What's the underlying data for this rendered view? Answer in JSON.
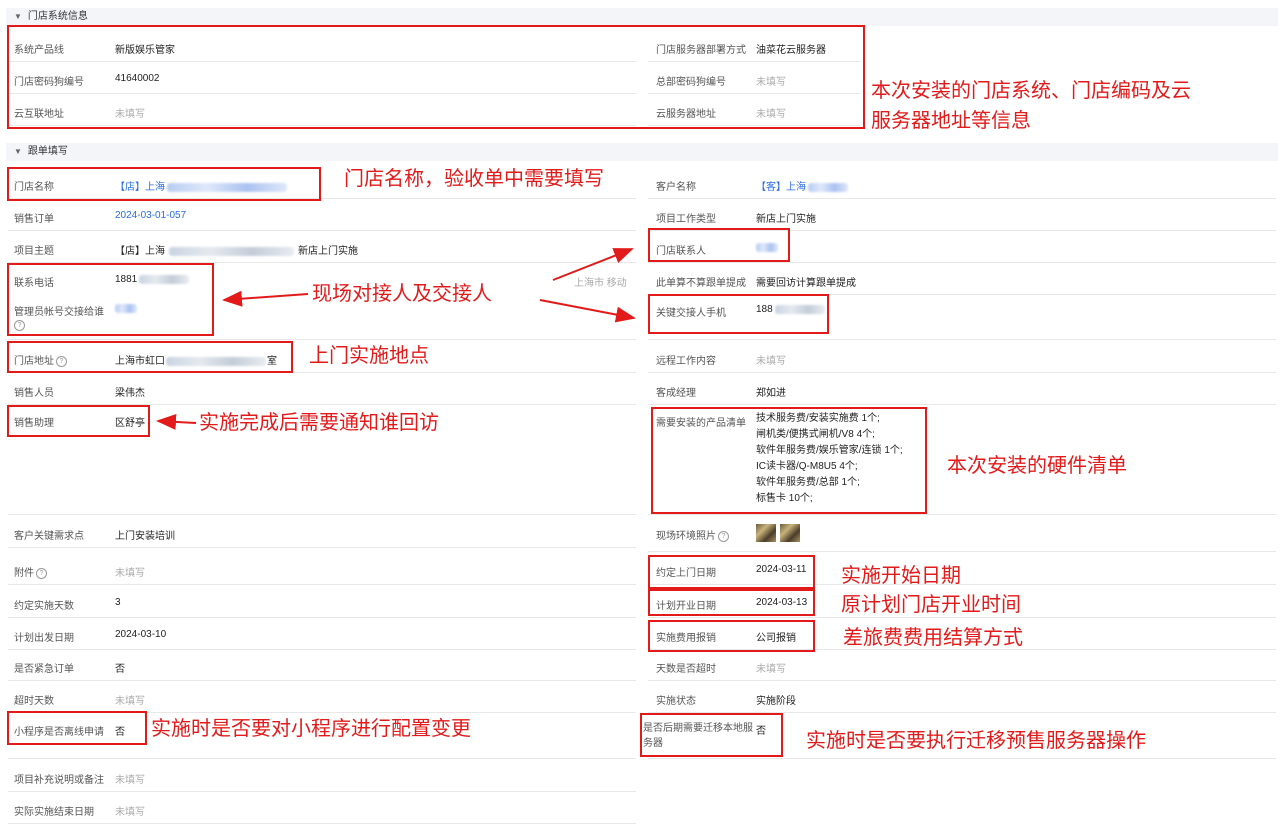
{
  "sections": {
    "store_system": {
      "title": "门店系统信息"
    },
    "order": {
      "title": "跟单填写"
    }
  },
  "store_system": {
    "product_line": {
      "label": "系统产品线",
      "value": "新版娱乐管家"
    },
    "deploy_method": {
      "label": "门店服务器部署方式",
      "value": "油菜花云服务器"
    },
    "store_code": {
      "label": "门店密码狗编号",
      "value": "41640002"
    },
    "hq_code": {
      "label": "总部密码狗编号",
      "value": "未填写"
    },
    "cloud_link": {
      "label": "云互联地址",
      "value": "未填写"
    },
    "cloud_server": {
      "label": "云服务器地址",
      "value": "未填写"
    }
  },
  "order": {
    "store_name": {
      "label": "门店名称",
      "value": "【店】上海"
    },
    "customer_name": {
      "label": "客户名称",
      "value": "【客】上海"
    },
    "sales_order": {
      "label": "销售订单",
      "value": "2024-03-01-057"
    },
    "project_type": {
      "label": "项目工作类型",
      "value": "新店上门实施"
    },
    "project_topic": {
      "label": "项目主题",
      "value": "【店】上海",
      "suffix": "新店上门实施"
    },
    "store_contact": {
      "label": "门店联系人",
      "value": ""
    },
    "phone": {
      "label": "联系电话",
      "value": "1881",
      "carrier": "上海市 移动"
    },
    "tracking_calc": {
      "label": "此单算不算跟单提成",
      "value": "需要回访计算跟单提成"
    },
    "admin_handover": {
      "label": "管理员帐号交接给谁",
      "value": ""
    },
    "key_contact_phone": {
      "label": "关键交接人手机",
      "value": "188"
    },
    "store_address": {
      "label": "门店地址",
      "value": "上海市虹口",
      "suffix": "室"
    },
    "remote_work": {
      "label": "远程工作内容",
      "value": "未填写"
    },
    "sales_person": {
      "label": "销售人员",
      "value": "梁伟杰"
    },
    "cs_manager": {
      "label": "客成经理",
      "value": "郑如进"
    },
    "sales_assistant": {
      "label": "销售助理",
      "value": "区舒亭"
    },
    "product_list": {
      "label": "需要安装的产品清单",
      "items": [
        "技术服务费/安装实施费 1个;",
        "闸机类/便携式闸机/V8 4个;",
        "软件年服务费/娱乐管家/连锁 1个;",
        "IC读卡器/Q-M8U5 4个;",
        "软件年服务费/总部 1个;",
        "标售卡 10个;"
      ]
    },
    "customer_key_needs": {
      "label": "客户关键需求点",
      "value": "上门安装培训"
    },
    "site_photos": {
      "label": "现场环境照片"
    },
    "attachment": {
      "label": "附件",
      "value": "未填写"
    },
    "visit_date": {
      "label": "约定上门日期",
      "value": "2024-03-11"
    },
    "impl_days": {
      "label": "约定实施天数",
      "value": "3"
    },
    "open_date": {
      "label": "计划开业日期",
      "value": "2024-03-13"
    },
    "depart_date": {
      "label": "计划出发日期",
      "value": "2024-03-10"
    },
    "expense": {
      "label": "实施费用报销",
      "value": "公司报销"
    },
    "urgent": {
      "label": "是否紧急订单",
      "value": "否"
    },
    "days_overtime": {
      "label": "天数是否超时",
      "value": "未填写"
    },
    "overtime_days": {
      "label": "超时天数",
      "value": "未填写"
    },
    "impl_status": {
      "label": "实施状态",
      "value": "实施阶段"
    },
    "mini_program": {
      "label": "小程序是否离线申请",
      "value": "否"
    },
    "migrate_server": {
      "label": "是否后期需要迁移本地服务器",
      "value": "否"
    },
    "supplement": {
      "label": "项目补充说明或备注",
      "value": "未填写"
    },
    "actual_end": {
      "label": "实际实施结束日期",
      "value": "未填写"
    }
  },
  "annotations": {
    "store_system": "本次安装的门店系统、门店编码及云",
    "store_system_2": "服务器地址等信息",
    "store_name": "门店名称，验收单中需要填写",
    "contacts": "现场对接人及交接人",
    "address": "上门实施地点",
    "assistant": "实施完成后需要通知谁回访",
    "hardware": "本次安装的硬件清单",
    "start_date": "实施开始日期",
    "open_date": "原计划门店开业时间",
    "expense": "差旅费费用结算方式",
    "mini_program": "实施时是否要对小程序进行配置变更",
    "migrate": "实施时是否要执行迁移预售服务器操作"
  },
  "colors": {
    "annotation": "#e21a1a",
    "link": "#2b6de0",
    "empty": "#aaaaaa",
    "header_bg": "#f3f5f8"
  }
}
